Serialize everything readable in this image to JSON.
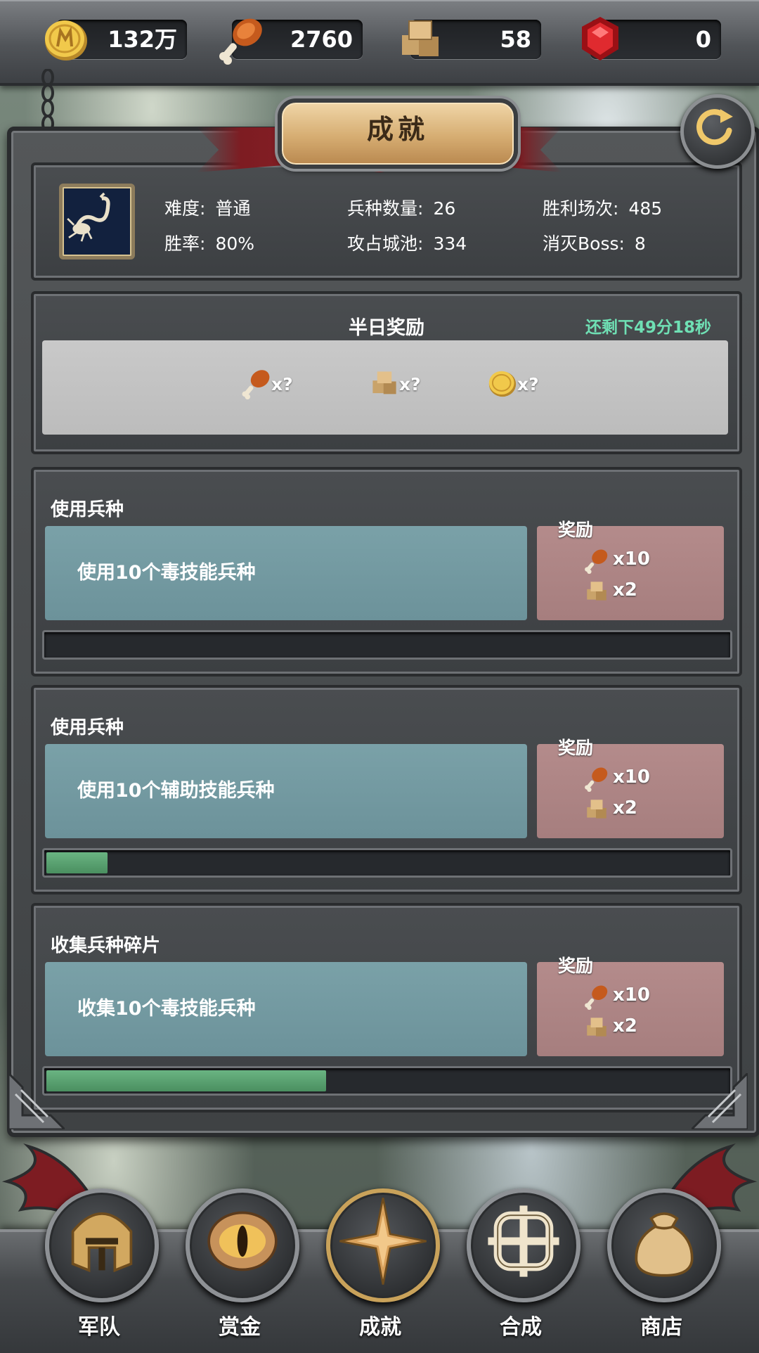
{
  "resources": {
    "gold": {
      "icon": "gold-coin-icon",
      "value": "132万"
    },
    "meat": {
      "icon": "meat-leg-icon",
      "value": "2760"
    },
    "stone": {
      "icon": "stone-block-icon",
      "value": "58"
    },
    "gem": {
      "icon": "red-gem-icon",
      "value": "0"
    }
  },
  "header": {
    "title": "成就"
  },
  "stats": {
    "difficulty_label": "难度:",
    "difficulty_value": "普通",
    "winrate_label": "胜率:",
    "winrate_value": "80%",
    "unit_types_label": "兵种数量:",
    "unit_types_value": "26",
    "cities_label": "攻占城池:",
    "cities_value": "334",
    "wins_label": "胜利场次:",
    "wins_value": "485",
    "boss_label": "消灭Boss:",
    "boss_value": "8"
  },
  "half_day": {
    "title": "半日奖励",
    "timer": "还剩下49分18秒",
    "items": [
      {
        "icon": "meat-leg-icon",
        "qty": "x?"
      },
      {
        "icon": "stone-block-icon",
        "qty": "x?"
      },
      {
        "icon": "gold-coin-icon",
        "qty": "x?"
      }
    ]
  },
  "achievements": [
    {
      "category": "使用兵种",
      "description": "使用10个毒技能兵种",
      "reward_label": "奖励",
      "rewards": [
        {
          "icon": "meat-leg-icon",
          "qty": "x10"
        },
        {
          "icon": "stone-block-icon",
          "qty": "x2"
        }
      ],
      "progress": 0.0
    },
    {
      "category": "使用兵种",
      "description": "使用10个辅助技能兵种",
      "reward_label": "奖励",
      "rewards": [
        {
          "icon": "meat-leg-icon",
          "qty": "x10"
        },
        {
          "icon": "stone-block-icon",
          "qty": "x2"
        }
      ],
      "progress": 0.09
    },
    {
      "category": "收集兵种碎片",
      "description": "收集10个毒技能兵种",
      "reward_label": "奖励",
      "rewards": [
        {
          "icon": "meat-leg-icon",
          "qty": "x10"
        },
        {
          "icon": "stone-block-icon",
          "qty": "x2"
        }
      ],
      "progress": 0.41
    }
  ],
  "nav": [
    {
      "label": "军队",
      "icon": "helmet-icon"
    },
    {
      "label": "赏金",
      "icon": "eye-icon"
    },
    {
      "label": "成就",
      "icon": "compass-star-icon"
    },
    {
      "label": "合成",
      "icon": "celtic-knot-icon"
    },
    {
      "label": "商店",
      "icon": "money-bag-icon"
    }
  ],
  "colors": {
    "timer": "#6fe0b4",
    "progress": "#5aa570",
    "title_plate": "#d6ad72",
    "banner": "#8f2229"
  }
}
